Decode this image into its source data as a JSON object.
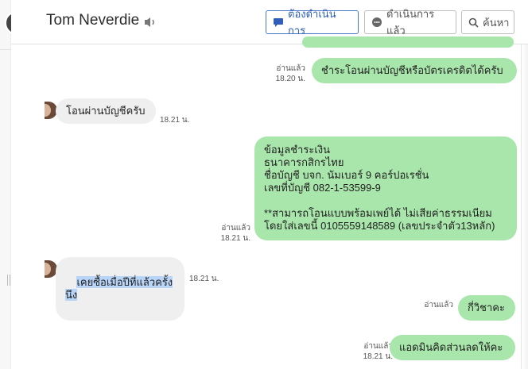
{
  "header": {
    "contact_name": "Tom Neverdie",
    "buttons": {
      "todo": "ต้องดำเนินการ",
      "done": "ดำเนินการแล้ว",
      "search": "ค้นหา"
    }
  },
  "messages": [
    {
      "dir": "out",
      "text": "ชำระโอนผ่านบัญชีหรือบัตรเครดิตได้ครับ",
      "read": "อ่านแล้ว",
      "time": "18.20 น."
    },
    {
      "dir": "in",
      "text": "โอนผ่านบัญชีครับ",
      "time": "18.21 น."
    },
    {
      "dir": "out",
      "text": "ข้อมูลชำระเงิน\nธนาคารกสิกรไทย\nชื่อบัญชี บจก. นัมเบอร์ 9 คอร์ปอเรชั่น\nเลขที่บัญชี 082-1-53599-9\n\n**สามารถโอนแบบพร้อมเพย์ได้ ไม่เสียค่าธรรมเนียม\nโดยใส่เลขนี้ 0105559148589 (เลขประจำตัว13หลัก)",
      "read": "อ่านแล้ว",
      "time": "18.21 น."
    },
    {
      "dir": "in",
      "text": "เคยซื้อเมื่อปีที่แล้วครั้งนึง",
      "time": "18.21 น."
    },
    {
      "dir": "out",
      "text": "กี่วิชาคะ",
      "read": "อ่านแล้ว",
      "time": ""
    },
    {
      "dir": "out",
      "text": "แอดมินคิดส่วนลดให้คะ",
      "read": "อ่านแล้ว",
      "time": "18.21 น."
    }
  ],
  "colors": {
    "outgoing_bubble": "#a9e6ab",
    "incoming_bubble": "#efefef",
    "accent": "#2f5fb8",
    "highlight": "#b8d4f7"
  },
  "icons": [
    "speaker-icon",
    "chat-bubble-icon",
    "chat-dots-icon",
    "search-icon"
  ]
}
